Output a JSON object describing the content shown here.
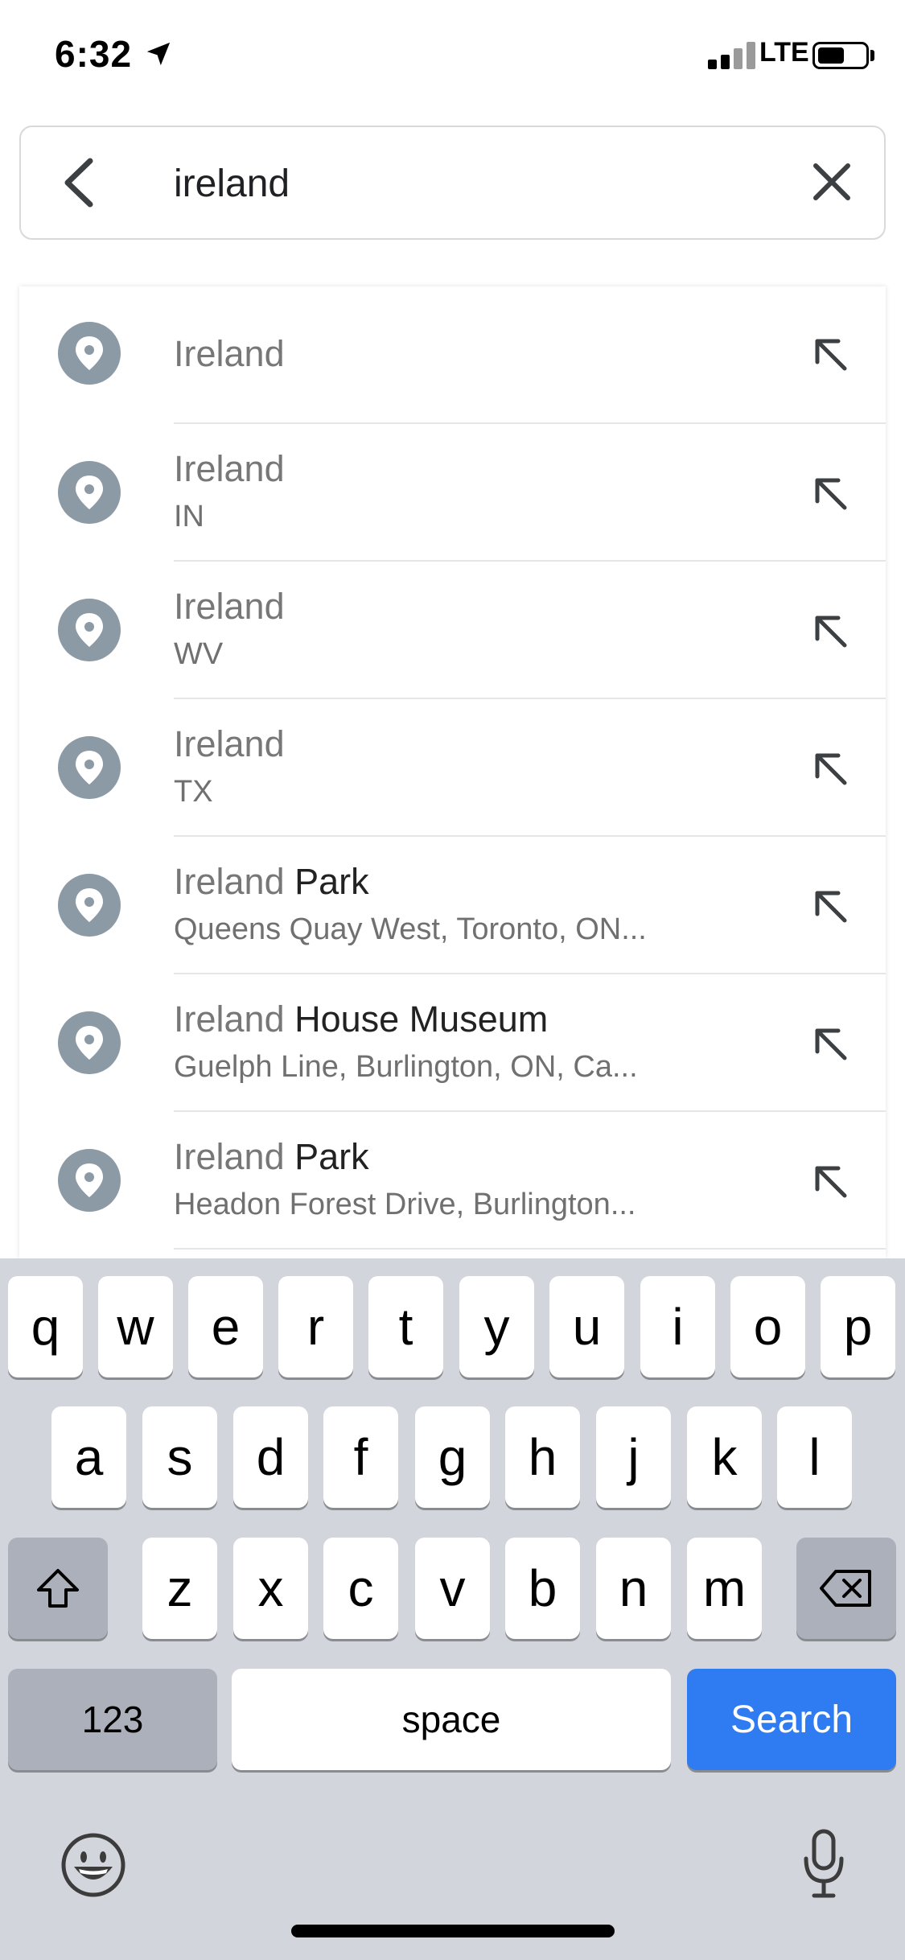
{
  "status_bar": {
    "time": "6:32",
    "network": "LTE",
    "icons": [
      "location-arrow-icon",
      "signal-icon",
      "battery-icon"
    ]
  },
  "search": {
    "query": "ireland",
    "back_icon": "back-arrow-icon",
    "clear_icon": "close-icon"
  },
  "results": [
    {
      "match": "Ireland",
      "rest": "",
      "subtitle": ""
    },
    {
      "match": "Ireland",
      "rest": "",
      "subtitle": "IN"
    },
    {
      "match": "Ireland",
      "rest": "",
      "subtitle": "WV"
    },
    {
      "match": "Ireland",
      "rest": "",
      "subtitle": "TX"
    },
    {
      "match": "Ireland",
      "rest": " Park",
      "subtitle": "Queens Quay West, Toronto, ON..."
    },
    {
      "match": "Ireland",
      "rest": " House Museum",
      "subtitle": "Guelph Line, Burlington, ON, Ca..."
    },
    {
      "match": "Ireland",
      "rest": " Park",
      "subtitle": "Headon Forest Drive, Burlington..."
    }
  ],
  "keyboard": {
    "row1": [
      "q",
      "w",
      "e",
      "r",
      "t",
      "y",
      "u",
      "i",
      "o",
      "p"
    ],
    "row2": [
      "a",
      "s",
      "d",
      "f",
      "g",
      "h",
      "j",
      "k",
      "l"
    ],
    "row3": [
      "z",
      "x",
      "c",
      "v",
      "b",
      "n",
      "m"
    ],
    "numbers_label": "123",
    "space_label": "space",
    "search_label": "Search",
    "accent_color": "#2f7bf1"
  }
}
